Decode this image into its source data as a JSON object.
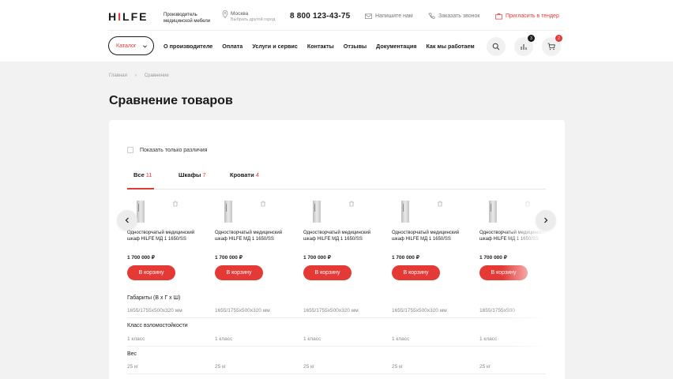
{
  "header": {
    "logo": {
      "part1": "H",
      "part2": "I",
      "part3": "LFE"
    },
    "tagline": "Производитель медицинской мебели",
    "city": "Москва",
    "city_sub": "Выбрать другой город",
    "phone": "8 800 123-43-75",
    "write_us": "Напишите нам",
    "call_me": "Заказать звонок",
    "tender": "Пригласить в тендер",
    "catalog": "Каталог",
    "nav": [
      "О производителе",
      "Оплата",
      "Услуги и сервис",
      "Контакты",
      "Отзывы",
      "Документация",
      "Как мы работаем"
    ],
    "compare_count": "3",
    "cart_count": "2",
    "accent": "#e53935"
  },
  "breadcrumb": {
    "home": "Главная",
    "current": "Сравнение"
  },
  "page_title": "Сравнение товаров",
  "filter": {
    "only_differences": "Показать только различия"
  },
  "tabs": [
    {
      "label": "Все",
      "count": "11"
    },
    {
      "label": "Шкафы",
      "count": "7"
    },
    {
      "label": "Кровати",
      "count": "4"
    }
  ],
  "products": [
    {
      "name": "Одностворчатый медицинский шкаф HILFE МД 1 1650/SS",
      "price": "1 700 000 ₽",
      "cart_label": "В корзину"
    },
    {
      "name": "Одностворчатый медицинский шкаф HILFE МД 1 1650/SS",
      "price": "1 700 000 ₽",
      "cart_label": "В корзину"
    },
    {
      "name": "Одностворчатый медицинский шкаф HILFE МД 1 1650/SS",
      "price": "1 700 000 ₽",
      "cart_label": "В корзину"
    },
    {
      "name": "Одностворчатый медицинский шкаф HILFE МД 1 1650/SS",
      "price": "1 700 000 ₽",
      "cart_label": "В корзину"
    },
    {
      "name": "Одностворчатый медицинский шкаф HILFE МД 1 1650/SS",
      "price": "1 700 000 ₽",
      "cart_label": "В корзину"
    }
  ],
  "specs": [
    {
      "label": "Габариты (В х Г х Ш)",
      "values": [
        "1655/1755х500х320 мм",
        "1655/1755х500х320 мм",
        "1655/1755х500х320 мм",
        "1655/1755х500х320 мм",
        "1655/1755х500"
      ]
    },
    {
      "label": "Класс взломостойкости",
      "values": [
        "1 класс",
        "1 класс",
        "1 класс",
        "1 класс",
        "1 класс"
      ]
    },
    {
      "label": "Вес",
      "values": [
        "25 кг",
        "25 кг",
        "25 кг",
        "25 кг",
        "25 кг"
      ]
    }
  ]
}
